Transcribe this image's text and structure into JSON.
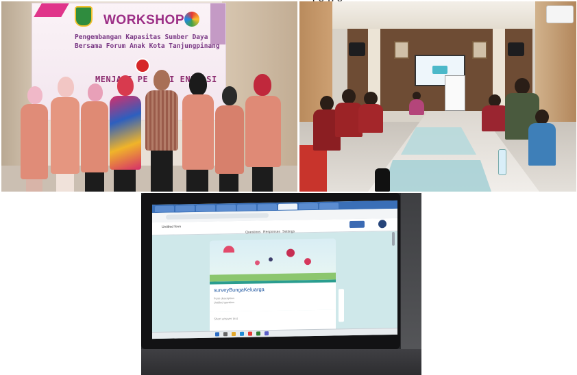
{
  "top_strip_text": "j g p g",
  "workshop_photo": {
    "banner": {
      "title": "WORKSHOP",
      "subtitle_line1": "Pengembangan Kapasitas Sumber Daya",
      "subtitle_line2": "Bersama Forum Anak Kota Tanjungpinang",
      "tagline": "MENJADI PE  LITI  ENERASI"
    }
  },
  "meeting_photo": {},
  "laptop_photo": {
    "browser": {
      "doc_title": "Untitled form",
      "send_label": "Send",
      "form_tabs": [
        "Questions",
        "Responses",
        "Settings"
      ]
    },
    "form": {
      "title": "surveyBungaKeluarga",
      "description_lines": [
        "Form description",
        "Untitled question"
      ],
      "question_label": "Short answer text"
    }
  },
  "colors": {
    "banner_magenta": "#e0358a",
    "banner_purple": "#9c2f86",
    "vest_salmon": "#e08c78",
    "uniform_maroon": "#8b1e22",
    "form_accent": "#2a9d8f"
  }
}
